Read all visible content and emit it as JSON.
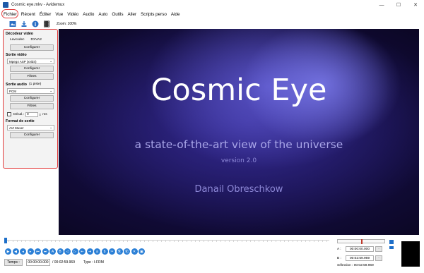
{
  "window": {
    "title": "Cosmic eye.mkv - Avidemux",
    "minimize": "—",
    "maximize": "☐",
    "close": "✕"
  },
  "menu": [
    "Fichier",
    "Récent",
    "Éditer",
    "Vue",
    "Vidéo",
    "Audio",
    "Auto",
    "Outils",
    "Aller",
    "Scripts perso",
    "Aide"
  ],
  "toolbar": {
    "zoom": "Zoom: 100%"
  },
  "left": {
    "video_decoder": {
      "title": "Décodeur vidéo",
      "lavcodec": "Lavcodec",
      "dxva": "DXVA2",
      "config": "Configurer"
    },
    "video_out": {
      "title": "Sortie vidéo",
      "codec": "Mpeg4 ASP (xvid4)",
      "config": "Configurer",
      "filters": "Filtres"
    },
    "audio_out": {
      "title": "Sortie audio",
      "tracks": "(1 piste)",
      "codec": "PCM",
      "config": "Configurer",
      "filters": "Filtres",
      "shift_label": "Décal.:",
      "shift_value": "0",
      "shift_unit": "ms"
    },
    "format": {
      "title": "Format de sortie",
      "muxer": "AVI Muxer",
      "config": "Configurer"
    }
  },
  "video": {
    "title": "Cosmic Eye",
    "subtitle": "a state-of-the-art view of the universe",
    "version": "version 2.0",
    "author": "Danail Obreschkow"
  },
  "time": {
    "button": "Temps :",
    "current": "00:00:00.000",
    "total": "/ 00:02:59.969",
    "type": "Type : I-FRM"
  },
  "selection": {
    "a_label": "A :",
    "a_value": "00:00:00.000",
    "b_label": "B :",
    "b_value": "00:02:59.969",
    "sel": "Sélection : 00:02:59.969"
  }
}
